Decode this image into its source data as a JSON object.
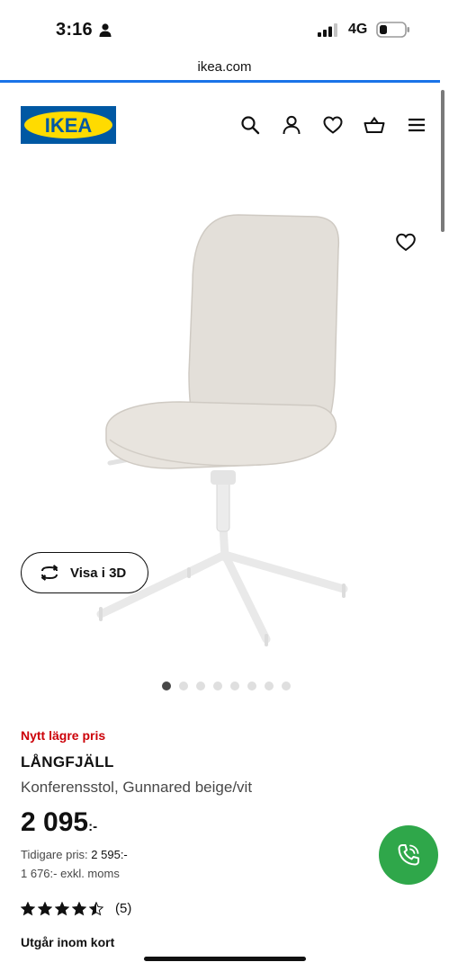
{
  "status_bar": {
    "time": "3:16",
    "network": "4G",
    "icons": [
      "person-icon",
      "signal-icon",
      "battery-icon"
    ]
  },
  "browser": {
    "url": "ikea.com"
  },
  "header": {
    "logo_text": "IKEA",
    "icons": [
      "search-icon",
      "user-icon",
      "heart-icon",
      "basket-icon",
      "menu-icon"
    ]
  },
  "gallery": {
    "view3d_label": "Visa i 3D",
    "dot_count": 8,
    "active_dot": 1
  },
  "product": {
    "badge": "Nytt lägre pris",
    "name": "LÅNGFJÄLL",
    "description": "Konferensstol, Gunnared beige/vit",
    "price": "2 095",
    "price_suffix": ":-",
    "previous_price_label": "Tidigare pris: ",
    "previous_price_value": "2 595:-",
    "excl_vat": "1 676:- exkl. moms",
    "rating": 4.5,
    "review_count": "(5)",
    "availability": "Utgår inom kort"
  },
  "colors": {
    "accent_red": "#cc0008",
    "ikea_blue": "#0058a3",
    "ikea_yellow": "#ffdb00",
    "call_green": "#2fa74a",
    "load_bar": "#1a73e8"
  }
}
